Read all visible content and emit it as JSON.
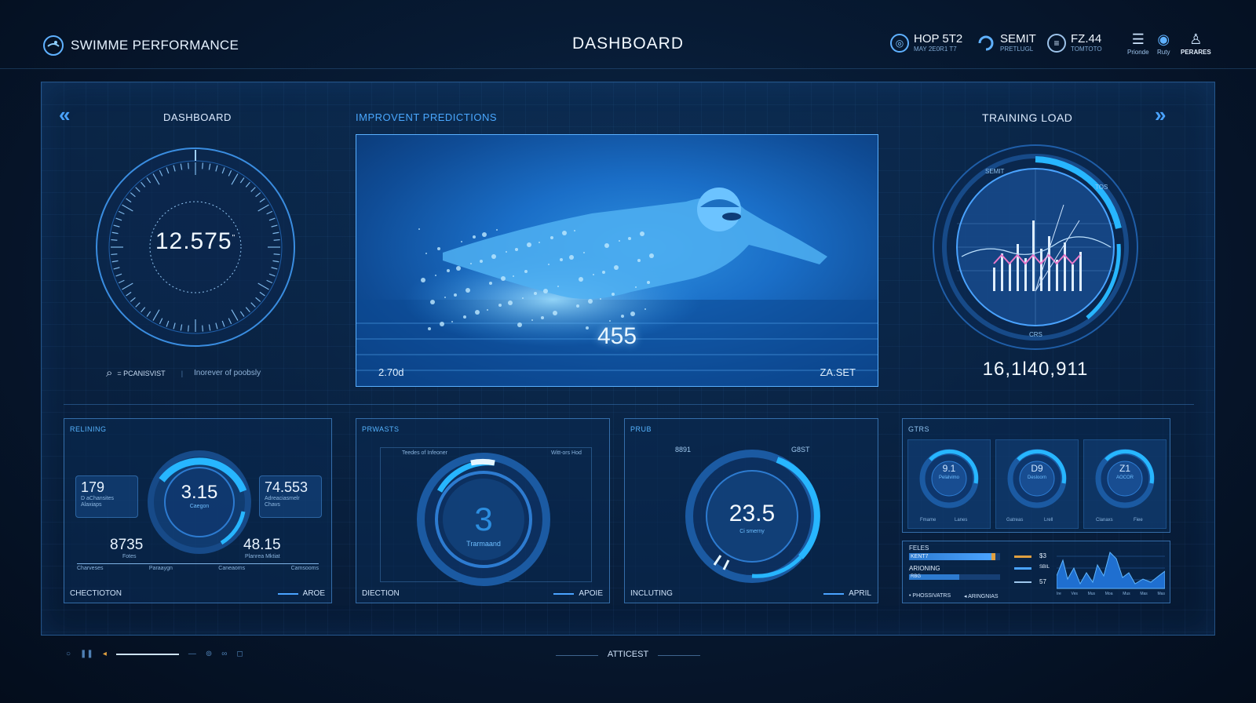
{
  "header": {
    "brand": "SWIMME PERFORMANCE",
    "title": "DASHBOARD",
    "stats": [
      {
        "value": "HOP 5T2",
        "sub": "MAY 2E0R1 T7"
      },
      {
        "value": "SEMIT",
        "sub": "PRETLUGL"
      },
      {
        "value": "FZ.44",
        "sub": "TOMTOTO"
      }
    ],
    "buttons": [
      {
        "label": "Prionde",
        "icon": "menu-icon"
      },
      {
        "label": "Ruty",
        "icon": "globe-icon"
      },
      {
        "label": "PERARES",
        "icon": "user-icon"
      }
    ]
  },
  "left_panel": {
    "title": "DASHBOARD",
    "gauge_value": "12.575",
    "gauge_unit": "\"",
    "search_label": "= PCANISVIST",
    "search_hint": "Inorever of poobsly"
  },
  "center_panel": {
    "title": "IMPROVENT PREDICTIONS",
    "video_value": "455",
    "video_left": "2.70d",
    "video_right": "ZA.SET"
  },
  "right_panel": {
    "title": "TRAINING LOAD",
    "value": "16,1l40,911",
    "ring_labels": [
      "SEMIT",
      "TOS",
      "CRS"
    ]
  },
  "cards": {
    "relining": {
      "title": "RELINING",
      "gauge_value": "3.15",
      "gauge_sub": "Caegon",
      "left_box_value": "179",
      "left_box_sub": "D aChansites Alaxiaps",
      "right_box_value": "74.553",
      "right_box_sub": "Adreaciasmelr Chavs",
      "bottom_left": "8735",
      "bottom_left_sub": "Fotes",
      "bottom_right": "48.15",
      "bottom_right_sub": "Planrea Mktiat",
      "axis": [
        "Charveses",
        "Paraaygn",
        "Caneaoms",
        "Camsooms"
      ],
      "foot_left": "CHECTIOTON",
      "foot_right": "AROE"
    },
    "prwasts": {
      "title": "PRWASTS",
      "gauge_value": "3",
      "gauge_sub": "Trarmaand",
      "tag_left": "Teedes of Infeoner",
      "tag_right": "Witt-ors Hod",
      "foot_left": "DIECTION",
      "foot_right": "APOIE"
    },
    "prub": {
      "title": "PRUB",
      "gauge_value": "23.5",
      "gauge_sub": "Ci smerny",
      "tag_left": "8891",
      "tag_right": "G8ST",
      "foot_left": "INCLUTING",
      "foot_right": "APRIL"
    },
    "gtrs": {
      "title": "GTRS",
      "dials": [
        {
          "value": "9.1",
          "sub": "Pelalvimo"
        },
        {
          "value": "D9",
          "sub": "Desloorn"
        },
        {
          "value": "Z1",
          "sub": "AOCOR"
        }
      ],
      "dial_labels": [
        "Fmame",
        "Lanes",
        "Gatreas",
        "Lrell",
        "Clanaxs",
        "Fiee"
      ]
    },
    "metrics": {
      "rows": [
        {
          "label": "FELES",
          "tag": "KENT7",
          "value": "$3",
          "fill": 0.95
        },
        {
          "label": "ARIONING",
          "tag": "RBG",
          "value": "SBIL",
          "fill": 0.55
        },
        {
          "label": "",
          "tag": "",
          "value": "57",
          "fill": 0.0
        }
      ],
      "legend": [
        "PHOSSIVATRS",
        "ARINGNIAS"
      ],
      "x_axis": [
        "Ire",
        "Ves",
        "Mus",
        "Moa",
        "Mus",
        "Mas",
        "Mas"
      ]
    }
  },
  "footer": {
    "center": "ATTICEST"
  },
  "colors": {
    "accent": "#4aa3ff",
    "glow": "#27b6ff",
    "bg": "#071a33",
    "trace": "#e879c9"
  }
}
